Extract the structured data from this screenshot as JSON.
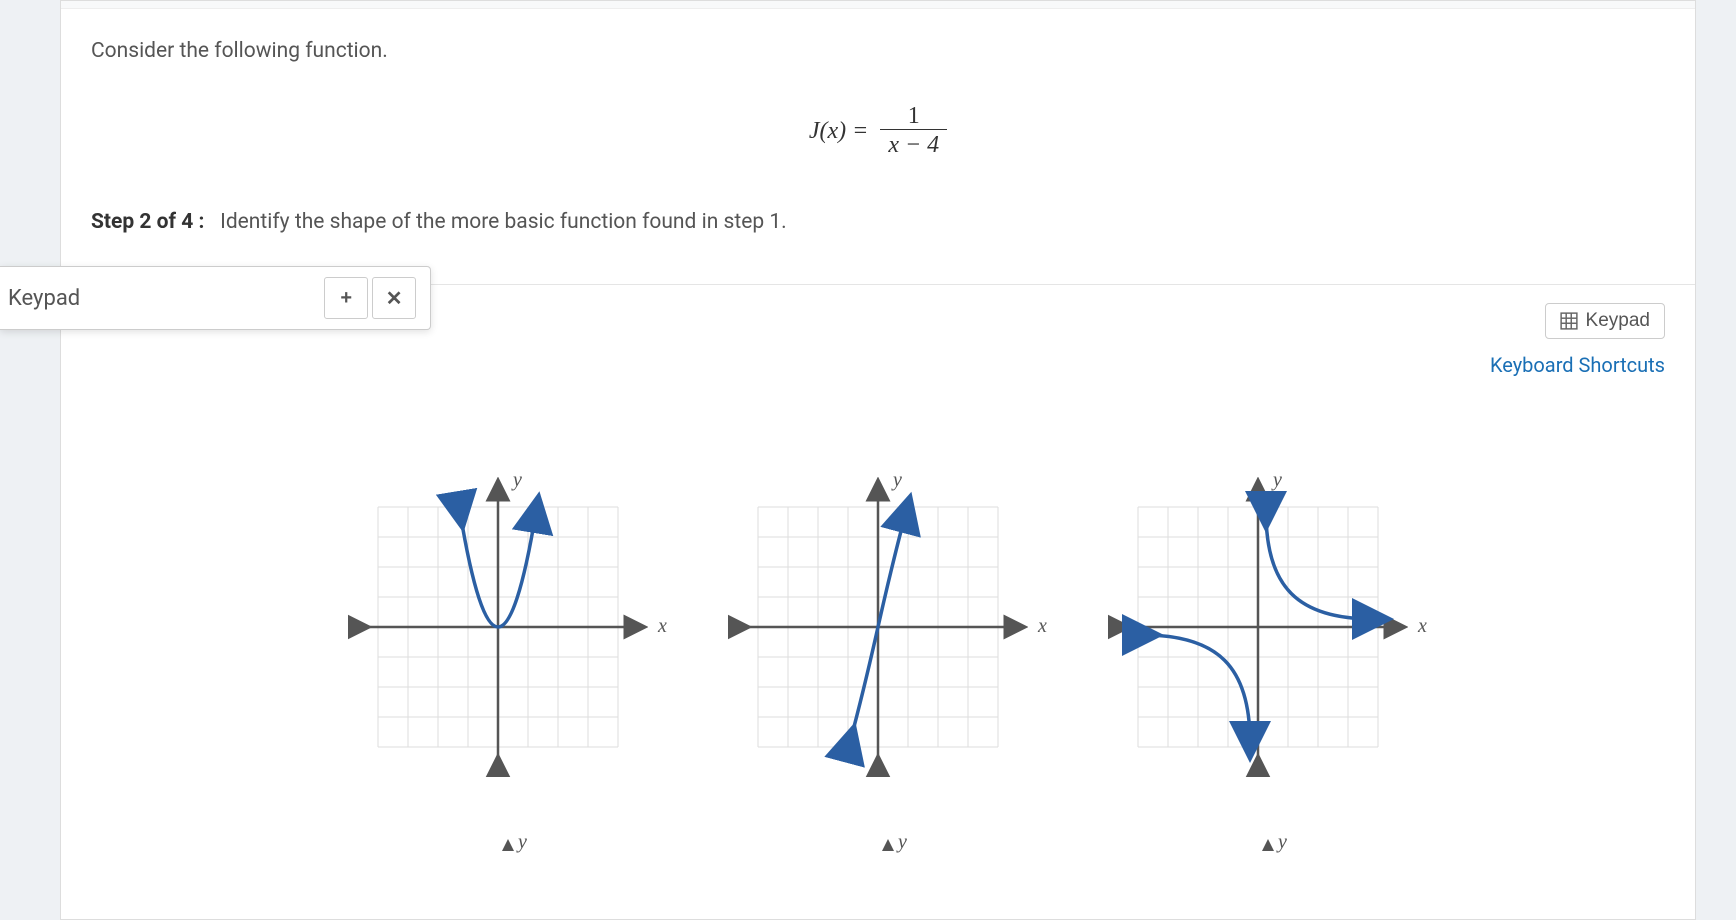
{
  "question": {
    "prompt": "Consider the following function.",
    "formula_lhs": "J(x) =",
    "formula_numerator": "1",
    "formula_denominator": "x − 4",
    "step_label": "Step 2 of 4 :",
    "step_text": "Identify the shape of the more basic function found in step 1."
  },
  "keypad": {
    "float_label": "Keypad",
    "plus": "+",
    "times": "✕",
    "button_label": "Keypad",
    "shortcuts_label": "Keyboard Shortcuts"
  },
  "axes": {
    "y": "y",
    "x": "x"
  },
  "graphs": [
    {
      "id": "option-parabola",
      "shape": "parabola"
    },
    {
      "id": "option-cubic",
      "shape": "cubic"
    },
    {
      "id": "option-reciprocal",
      "shape": "reciprocal"
    }
  ]
}
